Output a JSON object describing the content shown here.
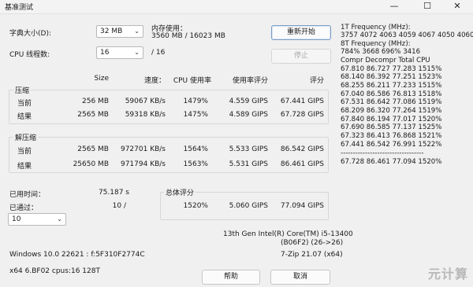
{
  "window": {
    "title": "基准测试",
    "minimize": "—",
    "maximize": "☐",
    "close": "✕"
  },
  "settings": {
    "dict_label": "字典大小(D):",
    "dict_value": "32 MB",
    "threads_label": "CPU 线程数:",
    "threads_value": "16",
    "threads_total": "/ 16",
    "mem_label": "内存使用：",
    "mem_value": "3560 MB / 16023 MB"
  },
  "buttons": {
    "restart": "重新开始",
    "stop": "停止",
    "help": "帮助",
    "cancel": "取消"
  },
  "headers": [
    "Size",
    "速度：",
    "CPU 使用率",
    "使用率评分",
    "评分"
  ],
  "compress": {
    "label": "压缩",
    "rows": [
      {
        "name": "当前",
        "size": "256 MB",
        "speed": "59067 KB/s",
        "cpu": "1479%",
        "usage": "4.559 GIPS",
        "rating": "67.441 GIPS"
      },
      {
        "name": "结果",
        "size": "2565 MB",
        "speed": "59318 KB/s",
        "cpu": "1475%",
        "usage": "4.589 GIPS",
        "rating": "67.728 GIPS"
      }
    ]
  },
  "decompress": {
    "label": "解压缩",
    "rows": [
      {
        "name": "当前",
        "size": "2565 MB",
        "speed": "972701 KB/s",
        "cpu": "1564%",
        "usage": "5.533 GIPS",
        "rating": "86.542 GIPS"
      },
      {
        "name": "结果",
        "size": "25650 MB",
        "speed": "971794 KB/s",
        "cpu": "1563%",
        "usage": "5.531 GIPS",
        "rating": "86.461 GIPS"
      }
    ]
  },
  "status": {
    "elapsed_label": "已用时间：",
    "elapsed_value": "75.187 s",
    "passes_label": "已通过：",
    "passes_value": "10 /",
    "passes_select": "10"
  },
  "total": {
    "label": "总体评分",
    "cpu": "1520%",
    "usage": "5.060 GIPS",
    "rating": "77.094 GIPS"
  },
  "cpu_info": {
    "line1": "13th Gen Intel(R) Core(TM) i5-13400",
    "line2": "(B06F2) (26->26)"
  },
  "system": {
    "os": "Windows 10.0 22621 : f:5F310F2774C",
    "arch": "x64 6.BF02 cpus:16 128T",
    "version": "7-Zip 21.07 (x64)"
  },
  "freq_panel": {
    "lines": [
      "1T Frequency (MHz):",
      " 3757 4072 4063 4059 4067 4050 4060",
      "8T Frequency (MHz):",
      " 784% 3668 696% 3416",
      "Compr Decompr Total  CPU",
      "67.810  86.727  77.283  1515%",
      "68.140  86.392  77.251  1523%",
      "68.255  86.211  77.233  1515%",
      "67.040  86.586  76.813  1518%",
      "67.531  86.642  77.086  1519%",
      "68.209  86.320  77.264  1519%",
      "67.840  86.194  77.017  1520%",
      "67.690  86.585  77.137  1525%",
      "67.323  86.413  76.868  1521%",
      "67.441  86.542  76.991  1522%",
      "----------------------------------",
      "67.728  86.461  77.094  1520%"
    ]
  },
  "watermark": "元计算"
}
